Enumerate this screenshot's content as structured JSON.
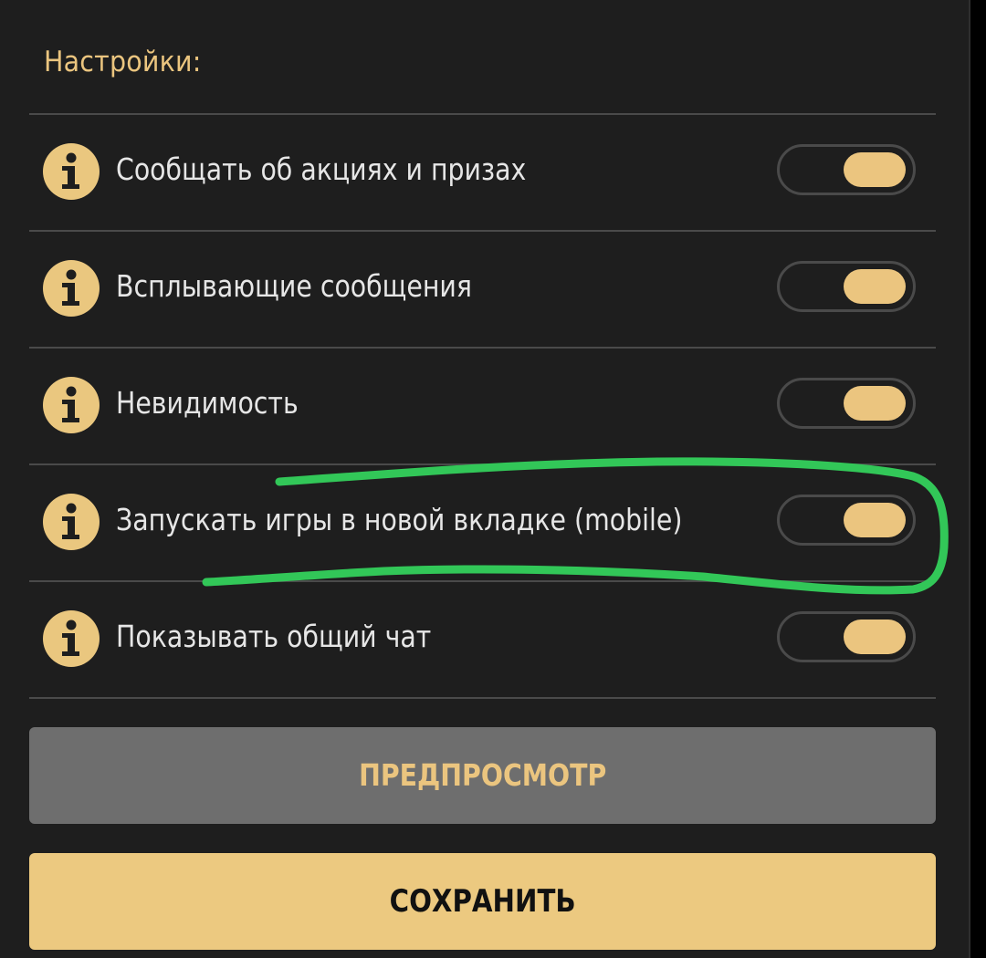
{
  "settings": {
    "title": "Настройки:",
    "items": [
      {
        "label": "Сообщать об акциях и призах",
        "enabled": true
      },
      {
        "label": "Всплывающие сообщения",
        "enabled": true
      },
      {
        "label": "Невидимость",
        "enabled": true
      },
      {
        "label": "Запускать игры в новой вкладке (mobile)",
        "enabled": true
      },
      {
        "label": "Показывать общий чат",
        "enabled": true
      }
    ]
  },
  "actions": {
    "preview_label": "ПРЕДПРОСМОТР",
    "save_label": "СОХРАНИТЬ"
  },
  "colors": {
    "accent": "#ebc57f",
    "background": "#1e1e1e",
    "preview_button": "#6e6e6e",
    "highlight_stroke": "#32c758"
  },
  "icons": {
    "row_icon": "info-icon"
  }
}
